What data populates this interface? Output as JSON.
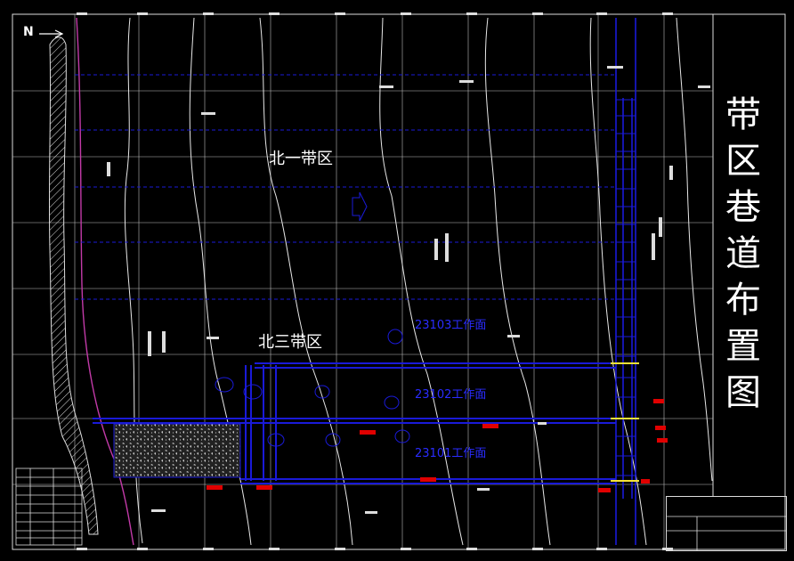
{
  "drawing": {
    "title_chars": [
      "带",
      "区",
      "巷",
      "道",
      "布",
      "置",
      "图"
    ],
    "north_label": "N",
    "zones": {
      "north_one": "北一带区",
      "north_three": "北三带区"
    },
    "faces": {
      "f23103": "23103工作面",
      "f23102": "23102工作面",
      "f23101": "23101工作面"
    }
  },
  "colors": {
    "background": "#000000",
    "roadway": "#1a1ad8",
    "contour": "#e8e8e8",
    "grid": "#cfcfcf",
    "boundary": "#c23aa8",
    "marker": "#e00000",
    "highlight": "#f5e23a"
  }
}
